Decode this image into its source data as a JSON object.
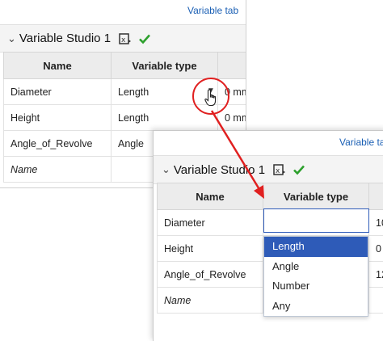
{
  "back": {
    "tab_link": "Variable tab",
    "studio_title": "Variable Studio 1",
    "columns": [
      "Name",
      "Variable type",
      ""
    ],
    "rows": [
      {
        "name": "Diameter",
        "type": "Length",
        "value": "0 mm"
      },
      {
        "name": "Height",
        "type": "Length",
        "value": "0 mm"
      },
      {
        "name": "Angle_of_Revolve",
        "type": "Angle",
        "value": ""
      }
    ],
    "new_row_placeholder": "Name"
  },
  "front": {
    "tab_link": "Variable ta",
    "studio_title": "Variable Studio 1",
    "columns": [
      "Name",
      "Variable type",
      ""
    ],
    "rows": [
      {
        "name": "Diameter",
        "type": "",
        "value": "10"
      },
      {
        "name": "Height",
        "type": "",
        "value": "0"
      },
      {
        "name": "Angle_of_Revolve",
        "type": "",
        "value": "12"
      }
    ],
    "new_row_placeholder": "Name",
    "type_options": [
      "Length",
      "Angle",
      "Number",
      "Any"
    ],
    "selected_option": "Length"
  },
  "colors": {
    "accent": "#2e5bb8",
    "check": "#2ca02c",
    "annotation": "#e02020"
  },
  "icons": {
    "collapse": "chevron-down-icon",
    "studio": "variable-studio-icon",
    "status": "checkmark-icon",
    "pointer": "hand-cursor-icon"
  }
}
